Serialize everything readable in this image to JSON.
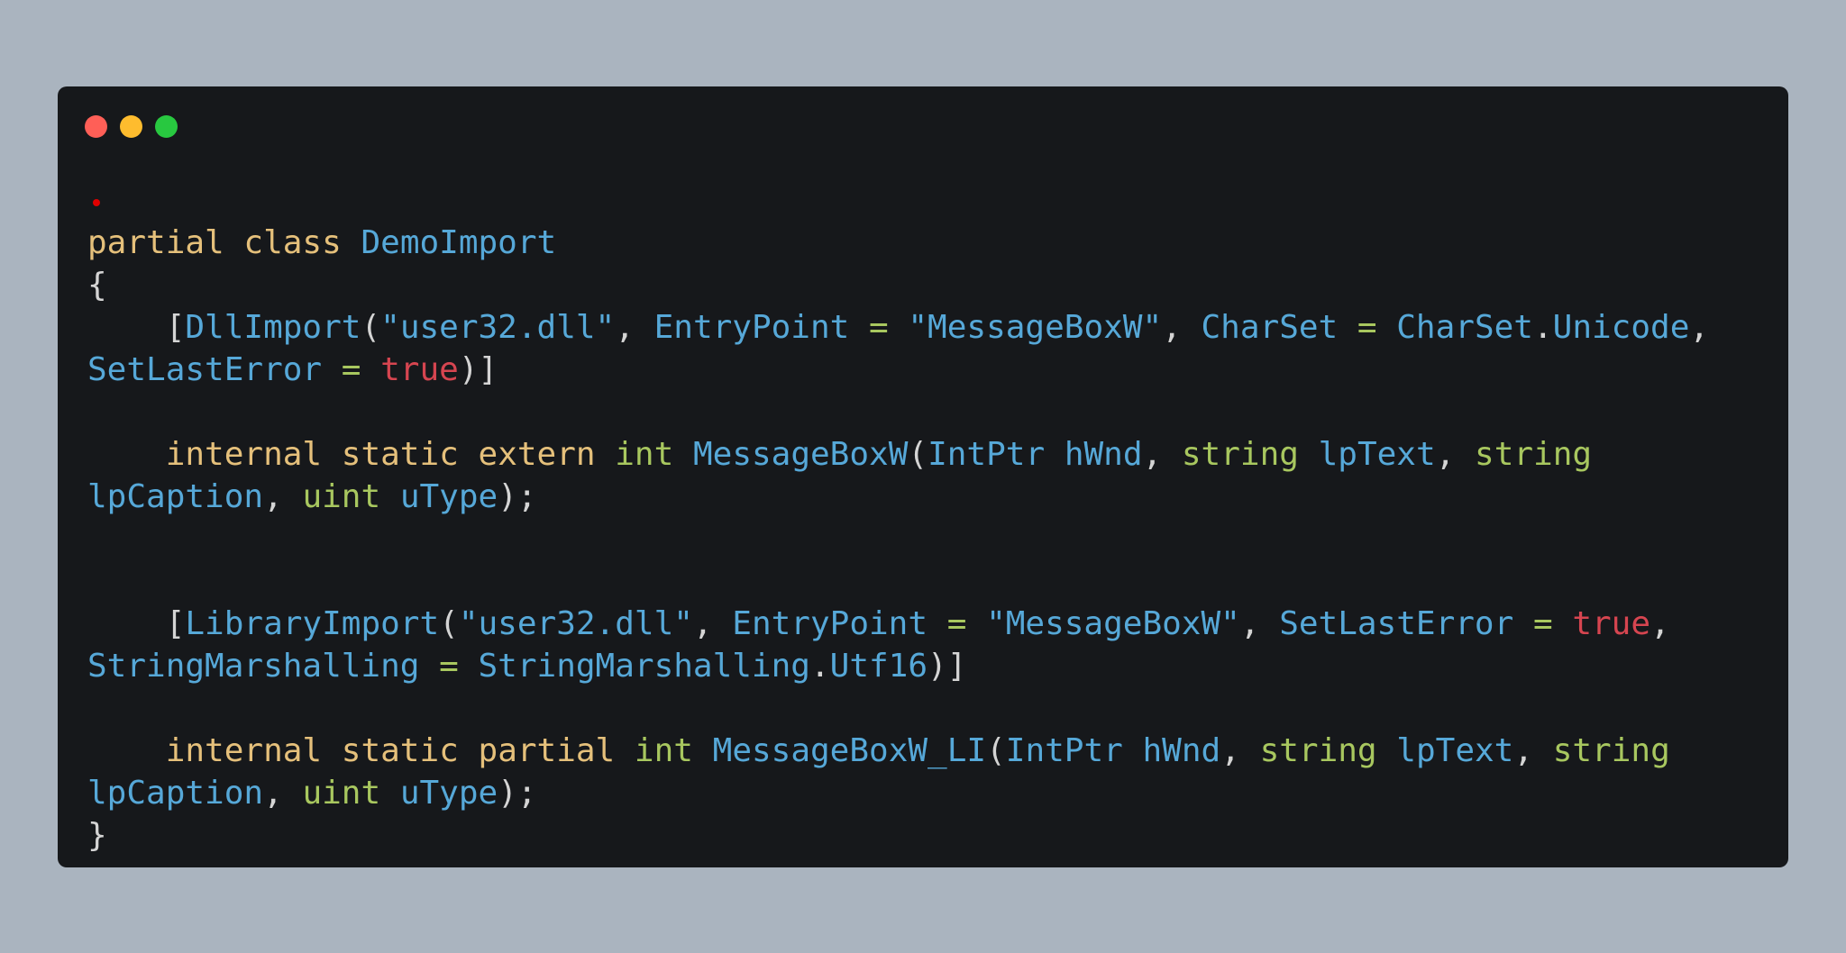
{
  "window": {
    "controls": {
      "close_color": "#ff5f57",
      "minimize_color": "#febc2e",
      "maximize_color": "#28c840"
    },
    "marker_color": "#e00000"
  },
  "code": {
    "lines": [
      {
        "tokens": [
          {
            "t": "partial",
            "k": "kw"
          },
          {
            "t": " ",
            "k": "pn"
          },
          {
            "t": "class",
            "k": "kw"
          },
          {
            "t": " ",
            "k": "pn"
          },
          {
            "t": "DemoImport",
            "k": "id"
          }
        ]
      },
      {
        "tokens": [
          {
            "t": "{",
            "k": "pn"
          }
        ]
      },
      {
        "tokens": [
          {
            "t": "    [",
            "k": "pn"
          },
          {
            "t": "DllImport",
            "k": "id"
          },
          {
            "t": "(",
            "k": "pn"
          },
          {
            "t": "\"user32.dll\"",
            "k": "str"
          },
          {
            "t": ", ",
            "k": "pn"
          },
          {
            "t": "EntryPoint",
            "k": "id"
          },
          {
            "t": " = ",
            "k": "op"
          },
          {
            "t": "\"MessageBoxW\"",
            "k": "str"
          },
          {
            "t": ", ",
            "k": "pn"
          },
          {
            "t": "CharSet",
            "k": "id"
          },
          {
            "t": " = ",
            "k": "op"
          },
          {
            "t": "CharSet",
            "k": "id"
          },
          {
            "t": ".",
            "k": "pn"
          },
          {
            "t": "Unicode",
            "k": "id"
          },
          {
            "t": ",",
            "k": "pn"
          }
        ]
      },
      {
        "tokens": [
          {
            "t": "SetLastError",
            "k": "id"
          },
          {
            "t": " = ",
            "k": "op"
          },
          {
            "t": "true",
            "k": "lit"
          },
          {
            "t": ")]",
            "k": "pn"
          }
        ]
      },
      {
        "tokens": []
      },
      {
        "tokens": [
          {
            "t": "    ",
            "k": "pn"
          },
          {
            "t": "internal",
            "k": "kw"
          },
          {
            "t": " ",
            "k": "pn"
          },
          {
            "t": "static",
            "k": "kw"
          },
          {
            "t": " ",
            "k": "pn"
          },
          {
            "t": "extern",
            "k": "kw"
          },
          {
            "t": " ",
            "k": "pn"
          },
          {
            "t": "int",
            "k": "ty"
          },
          {
            "t": " ",
            "k": "pn"
          },
          {
            "t": "MessageBoxW",
            "k": "id"
          },
          {
            "t": "(",
            "k": "pn"
          },
          {
            "t": "IntPtr",
            "k": "id"
          },
          {
            "t": " ",
            "k": "pn"
          },
          {
            "t": "hWnd",
            "k": "id"
          },
          {
            "t": ", ",
            "k": "pn"
          },
          {
            "t": "string",
            "k": "ty"
          },
          {
            "t": " ",
            "k": "pn"
          },
          {
            "t": "lpText",
            "k": "id"
          },
          {
            "t": ", ",
            "k": "pn"
          },
          {
            "t": "string",
            "k": "ty"
          }
        ]
      },
      {
        "tokens": [
          {
            "t": "lpCaption",
            "k": "id"
          },
          {
            "t": ", ",
            "k": "pn"
          },
          {
            "t": "uint",
            "k": "ty"
          },
          {
            "t": " ",
            "k": "pn"
          },
          {
            "t": "uType",
            "k": "id"
          },
          {
            "t": ");",
            "k": "pn"
          }
        ]
      },
      {
        "tokens": []
      },
      {
        "tokens": []
      },
      {
        "tokens": [
          {
            "t": "    [",
            "k": "pn"
          },
          {
            "t": "LibraryImport",
            "k": "id"
          },
          {
            "t": "(",
            "k": "pn"
          },
          {
            "t": "\"user32.dll\"",
            "k": "str"
          },
          {
            "t": ", ",
            "k": "pn"
          },
          {
            "t": "EntryPoint",
            "k": "id"
          },
          {
            "t": " = ",
            "k": "op"
          },
          {
            "t": "\"MessageBoxW\"",
            "k": "str"
          },
          {
            "t": ", ",
            "k": "pn"
          },
          {
            "t": "SetLastError",
            "k": "id"
          },
          {
            "t": " = ",
            "k": "op"
          },
          {
            "t": "true",
            "k": "lit"
          },
          {
            "t": ",",
            "k": "pn"
          }
        ]
      },
      {
        "tokens": [
          {
            "t": "StringMarshalling",
            "k": "id"
          },
          {
            "t": " = ",
            "k": "op"
          },
          {
            "t": "StringMarshalling",
            "k": "id"
          },
          {
            "t": ".",
            "k": "pn"
          },
          {
            "t": "Utf16",
            "k": "id"
          },
          {
            "t": ")]",
            "k": "pn"
          }
        ]
      },
      {
        "tokens": []
      },
      {
        "tokens": [
          {
            "t": "    ",
            "k": "pn"
          },
          {
            "t": "internal",
            "k": "kw"
          },
          {
            "t": " ",
            "k": "pn"
          },
          {
            "t": "static",
            "k": "kw"
          },
          {
            "t": " ",
            "k": "pn"
          },
          {
            "t": "partial",
            "k": "kw"
          },
          {
            "t": " ",
            "k": "pn"
          },
          {
            "t": "int",
            "k": "ty"
          },
          {
            "t": " ",
            "k": "pn"
          },
          {
            "t": "MessageBoxW_LI",
            "k": "id"
          },
          {
            "t": "(",
            "k": "pn"
          },
          {
            "t": "IntPtr",
            "k": "id"
          },
          {
            "t": " ",
            "k": "pn"
          },
          {
            "t": "hWnd",
            "k": "id"
          },
          {
            "t": ", ",
            "k": "pn"
          },
          {
            "t": "string",
            "k": "ty"
          },
          {
            "t": " ",
            "k": "pn"
          },
          {
            "t": "lpText",
            "k": "id"
          },
          {
            "t": ", ",
            "k": "pn"
          },
          {
            "t": "string",
            "k": "ty"
          }
        ]
      },
      {
        "tokens": [
          {
            "t": "lpCaption",
            "k": "id"
          },
          {
            "t": ", ",
            "k": "pn"
          },
          {
            "t": "uint",
            "k": "ty"
          },
          {
            "t": " ",
            "k": "pn"
          },
          {
            "t": "uType",
            "k": "id"
          },
          {
            "t": ");",
            "k": "pn"
          }
        ]
      },
      {
        "tokens": [
          {
            "t": "}",
            "k": "pn"
          }
        ]
      }
    ]
  }
}
